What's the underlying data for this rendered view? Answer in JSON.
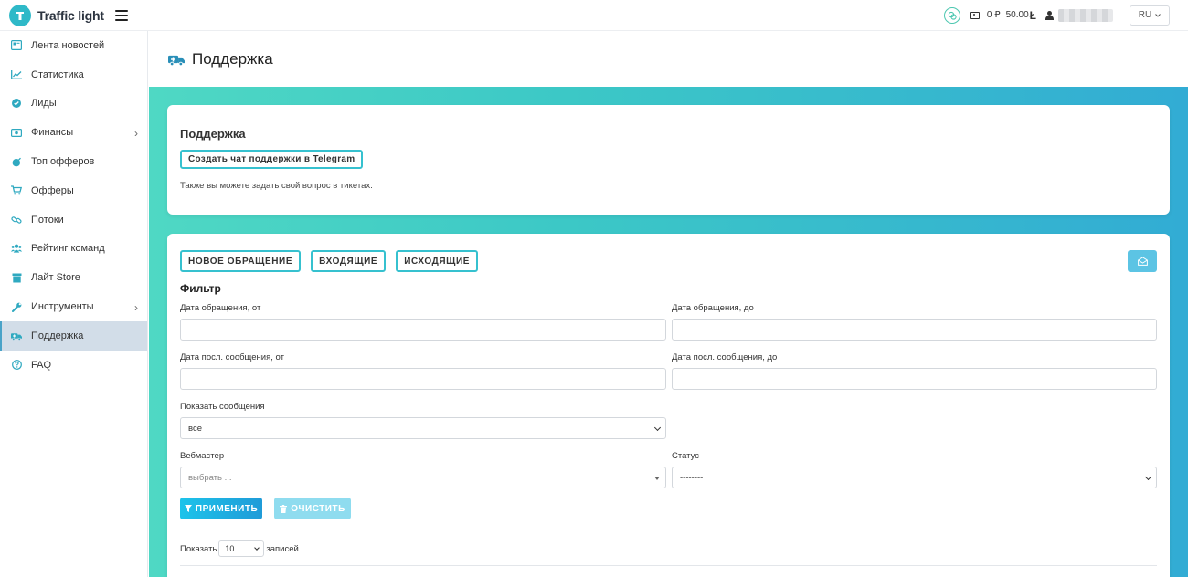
{
  "header": {
    "app_name": "Traffic light",
    "balance_rub": "0 ₽",
    "balance_other": "50.00",
    "currency_symbol": "Ł",
    "language": "RU"
  },
  "sidebar": {
    "items": [
      {
        "label": "Лента новостей",
        "icon": "newspaper-icon"
      },
      {
        "label": "Статистика",
        "icon": "chart-line-icon"
      },
      {
        "label": "Лиды",
        "icon": "check-circle-icon"
      },
      {
        "label": "Финансы",
        "icon": "money-icon"
      },
      {
        "label": "Топ офферов",
        "icon": "bomb-icon"
      },
      {
        "label": "Офферы",
        "icon": "cart-icon"
      },
      {
        "label": "Потоки",
        "icon": "link-icon"
      },
      {
        "label": "Рейтинг команд",
        "icon": "users-icon"
      },
      {
        "label": "Лайт Store",
        "icon": "store-icon"
      },
      {
        "label": "Инструменты",
        "icon": "wrench-icon"
      },
      {
        "label": "Поддержка",
        "icon": "support-icon"
      },
      {
        "label": "FAQ",
        "icon": "question-icon"
      }
    ],
    "active": "Поддержка"
  },
  "page": {
    "title": "Поддержка"
  },
  "support_card": {
    "title": "Поддержка",
    "telegram_button": "Создать чат поддержки в Telegram",
    "note": "Также вы можете задать свой вопрос в тикетах."
  },
  "tickets": {
    "tabs": [
      "НОВОЕ ОБРАЩЕНИЕ",
      "ВХОДЯЩИЕ",
      "ИСХОДЯЩИЕ"
    ],
    "filter_title": "Фильтр",
    "fields": {
      "date_from_label": "Дата обращения, от",
      "date_to_label": "Дата обращения, до",
      "last_msg_from_label": "Дата посл. сообщения, от",
      "last_msg_to_label": "Дата посл. сообщения, до",
      "show_messages_label": "Показать сообщения",
      "show_messages_value": "все",
      "webmaster_label": "Вебмастер",
      "webmaster_placeholder": "выбрать ...",
      "status_label": "Статус",
      "status_value": "--------"
    },
    "apply_button": "ПРИМЕНИТЬ",
    "clear_button": "ОЧИСТИТЬ",
    "show_prefix": "Показать",
    "page_size": "10",
    "show_suffix": "записей"
  },
  "colors": {
    "accent": "#36c1cf",
    "gradient_start": "#4fd8c4",
    "gradient_end": "#32acd4",
    "apply": "#1dc3ea"
  }
}
